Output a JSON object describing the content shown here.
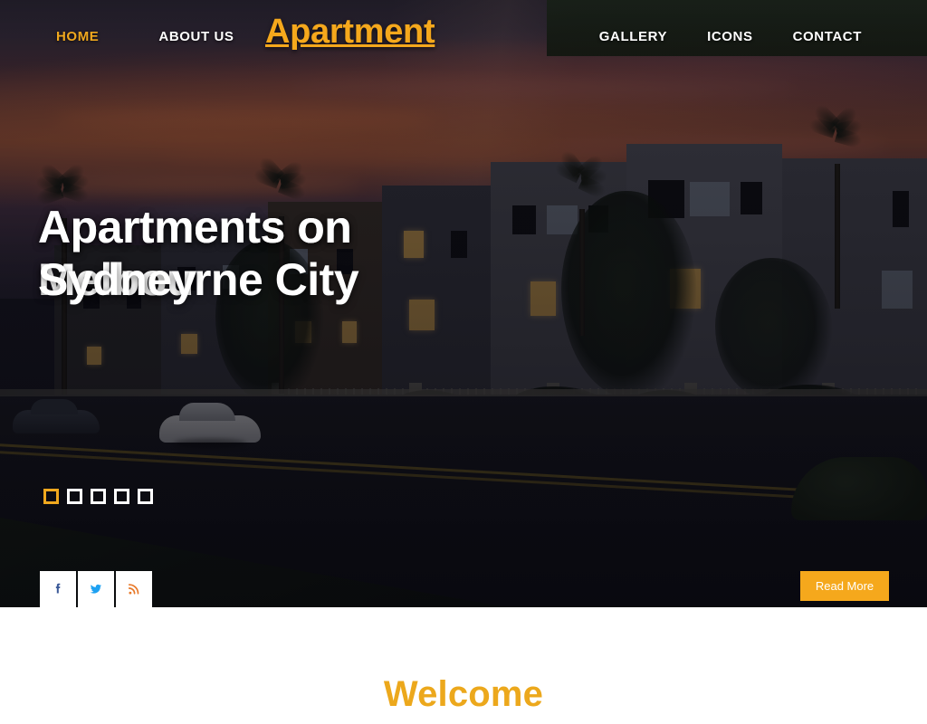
{
  "site": {
    "brand": "Apartment",
    "brand_color": "#f5a81c"
  },
  "navbar": {
    "left_links": [
      {
        "label": "HOME",
        "active": true
      },
      {
        "label": "ABOUT US",
        "active": false
      }
    ],
    "right_links": [
      {
        "label": "GALLERY",
        "active": false
      },
      {
        "label": "ICONS",
        "active": false
      },
      {
        "label": "CONTACT",
        "active": false
      }
    ]
  },
  "hero": {
    "captions": [
      "Apartments on Melbourne City",
      "Apartments on Sydney"
    ],
    "slider": {
      "total_dots": 5,
      "active_index": 0
    },
    "socials": [
      {
        "name": "facebook-icon",
        "glyph": "f",
        "color": "#3b5998"
      },
      {
        "name": "twitter-icon",
        "glyph": "t",
        "color": "#1da1f2"
      },
      {
        "name": "rss-icon",
        "glyph": "r",
        "color": "#e8792a"
      }
    ],
    "read_more_label": "Read More",
    "read_more_color": "#f5a81c"
  },
  "welcome": {
    "title": "Welcome",
    "title_color": "#eca81c"
  }
}
